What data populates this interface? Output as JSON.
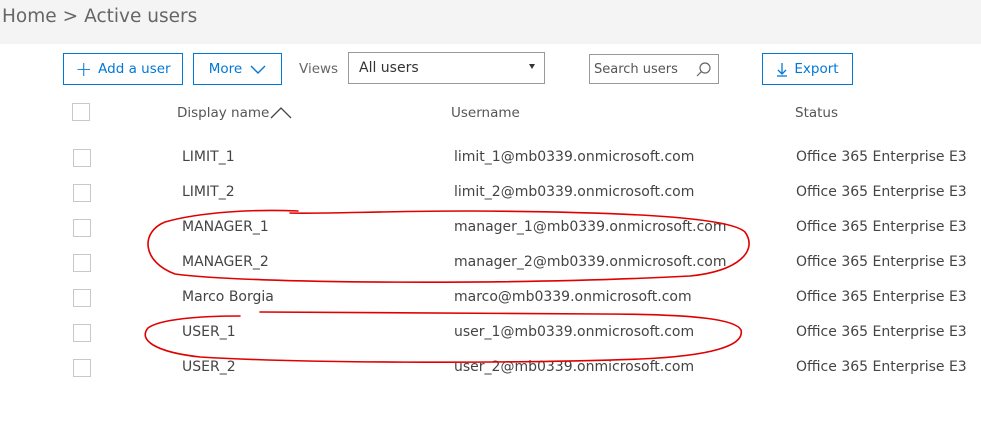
{
  "breadcrumb": {
    "home": "Home",
    "separator": ">",
    "current": "Active users"
  },
  "toolbar": {
    "add_user": "Add a user",
    "more": "More",
    "views_label": "Views",
    "views_selected": "All users",
    "search_placeholder": "Search users",
    "export": "Export"
  },
  "table": {
    "headers": {
      "display_name": "Display name",
      "username": "Username",
      "status": "Status"
    },
    "rows": [
      {
        "display_name": "LIMIT_1",
        "username": "limit_1@mb0339.onmicrosoft.com",
        "status": "Office 365 Enterprise E3"
      },
      {
        "display_name": "LIMIT_2",
        "username": "limit_2@mb0339.onmicrosoft.com",
        "status": "Office 365 Enterprise E3"
      },
      {
        "display_name": "MANAGER_1",
        "username": "manager_1@mb0339.onmicrosoft.com",
        "status": "Office 365 Enterprise E3"
      },
      {
        "display_name": "MANAGER_2",
        "username": "manager_2@mb0339.onmicrosoft.com",
        "status": "Office 365 Enterprise E3"
      },
      {
        "display_name": "Marco Borgia",
        "username": "marco@mb0339.onmicrosoft.com",
        "status": "Office 365 Enterprise E3"
      },
      {
        "display_name": "USER_1",
        "username": "user_1@mb0339.onmicrosoft.com",
        "status": "Office 365 Enterprise E3"
      },
      {
        "display_name": "USER_2",
        "username": "user_2@mb0339.onmicrosoft.com",
        "status": "Office 365 Enterprise E3"
      }
    ]
  },
  "colors": {
    "accent": "#0078d7",
    "annotation": "#e00000",
    "header_bg": "#f4f4f4"
  },
  "icons": {
    "add": "plus-icon",
    "more": "chevron-down-icon",
    "views": "dropdown-arrow-icon",
    "search": "search-icon",
    "export": "download-icon",
    "sort": "sort-ascending-icon"
  }
}
